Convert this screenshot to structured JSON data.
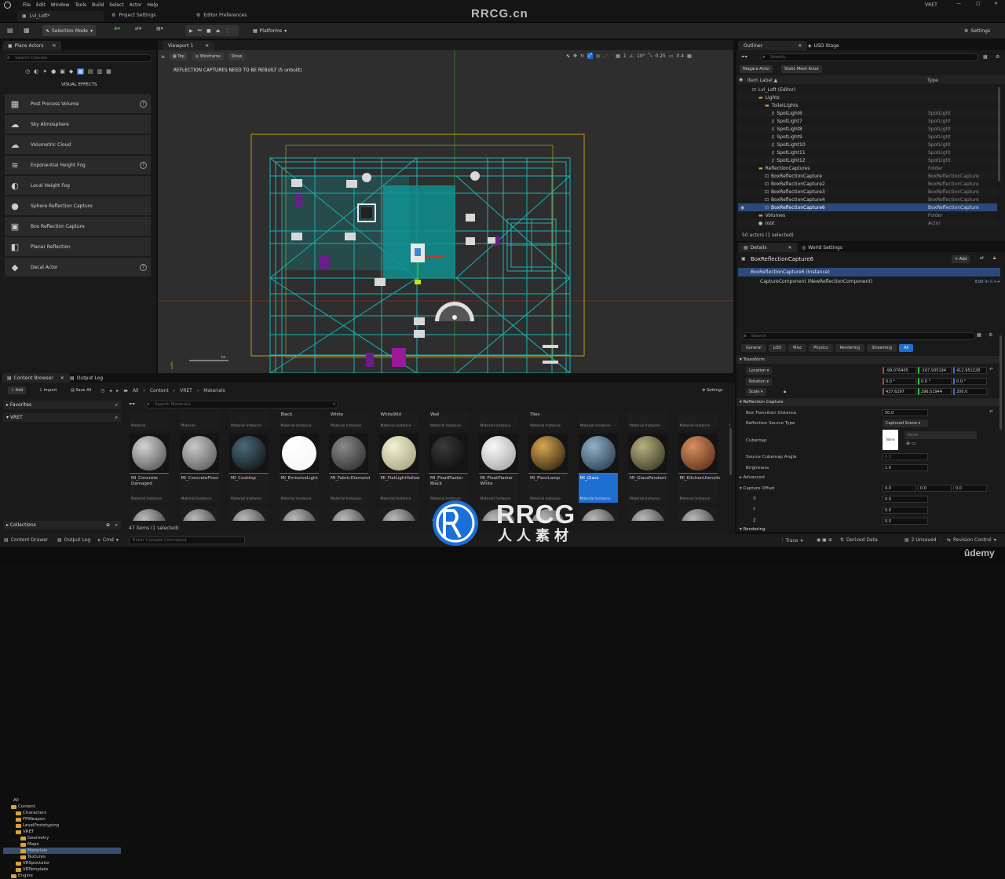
{
  "menu": [
    "File",
    "Edit",
    "Window",
    "Tools",
    "Build",
    "Select",
    "Actor",
    "Help"
  ],
  "window": {
    "level_tab": "Lvl_Loft*",
    "project_settings": "Project Settings",
    "editor_prefs": "Editor Preferences",
    "user": "VRET"
  },
  "watermark": {
    "top": "RRCG.cn",
    "logo_main": "RRCG",
    "logo_sub": "人人素材",
    "udemy": "ûdemy"
  },
  "toolbar": {
    "selection_mode": "Selection Mode",
    "platforms": "Platforms",
    "settings": "Settings"
  },
  "place_actors": {
    "tab": "Place Actors",
    "search_placeholder": "Search Classes",
    "category": "VISUAL EFFECTS",
    "items": [
      {
        "label": "Post Process Volume",
        "help": true
      },
      {
        "label": "Sky Atmosphere",
        "help": false
      },
      {
        "label": "Volumetric Cloud",
        "help": false
      },
      {
        "label": "Exponential Height Fog",
        "help": true
      },
      {
        "label": "Local Height Fog",
        "help": false
      },
      {
        "label": "Sphere Reflection Capture",
        "help": false
      },
      {
        "label": "Box Reflection Capture",
        "help": false
      },
      {
        "label": "Planar Reflection",
        "help": false
      },
      {
        "label": "Decal Actor",
        "help": true
      }
    ]
  },
  "viewport": {
    "tab": "Viewport 1",
    "view": "Top",
    "mode": "Wireframe",
    "show": "Show",
    "warning": "REFLECTION CAPTURES NEED TO BE REBUILT (5 unbuilt)",
    "snap_angle": "10°",
    "snap_scale": "0.25",
    "cam_speed": "0.4",
    "grid": "1",
    "scale_bar": "1m"
  },
  "outliner": {
    "tab": "Outliner",
    "tab2": "USD Stage",
    "search_placeholder": "Search...",
    "filters": [
      "Niagara Actor",
      "Static Mesh Actor"
    ],
    "col_label": "Item Label ▲",
    "col_type": "Type",
    "rows": [
      {
        "label": "Lvl_Loft (Editor)",
        "type": "",
        "indent": 1
      },
      {
        "label": "Lights",
        "type": "",
        "indent": 2
      },
      {
        "label": "ToiletLights",
        "type": "",
        "indent": 3
      },
      {
        "label": "SpotLight6",
        "type": "SpotLight",
        "indent": 4
      },
      {
        "label": "SpotLight7",
        "type": "SpotLight",
        "indent": 4
      },
      {
        "label": "SpotLight8",
        "type": "SpotLight",
        "indent": 4
      },
      {
        "label": "SpotLight9",
        "type": "SpotLight",
        "indent": 4
      },
      {
        "label": "SpotLight10",
        "type": "SpotLight",
        "indent": 4
      },
      {
        "label": "SpotLight11",
        "type": "SpotLight",
        "indent": 4
      },
      {
        "label": "SpotLight12",
        "type": "SpotLight",
        "indent": 4
      },
      {
        "label": "ReflectionCaptures",
        "type": "Folder",
        "indent": 2
      },
      {
        "label": "BoxReflectionCapture",
        "type": "BoxReflectionCapture",
        "indent": 3
      },
      {
        "label": "BoxReflectionCapture2",
        "type": "BoxReflectionCapture",
        "indent": 3
      },
      {
        "label": "BoxReflectionCapture3",
        "type": "BoxReflectionCapture",
        "indent": 3
      },
      {
        "label": "BoxReflectionCapture4",
        "type": "BoxReflectionCapture",
        "indent": 3
      },
      {
        "label": "BoxReflectionCapture6",
        "type": "BoxReflectionCapture",
        "indent": 3,
        "selected": true
      },
      {
        "label": "Volumes",
        "type": "Folder",
        "indent": 2
      },
      {
        "label": "root",
        "type": "Actor",
        "indent": 2
      }
    ],
    "status": "50 actors (1 selected)"
  },
  "details": {
    "tab": "Details",
    "tab2": "World Settings",
    "title": "BoxReflectionCapture6",
    "add": "+ Add",
    "instance": "BoxReflectionCapture6 (Instance)",
    "component": "CaptureComponent (NewReflectionComponent)",
    "edit_cpp": "Edit in C++",
    "search_placeholder": "Search",
    "tabs": [
      "General",
      "LOD",
      "Misc",
      "Physics",
      "Rendering",
      "Streaming",
      "All"
    ],
    "transform": "Transform",
    "location": {
      "label": "Location",
      "x": "-99.076405",
      "y": "-167.935194",
      "z": "412.951228"
    },
    "rotation": {
      "label": "Rotation",
      "x": "0.0 °",
      "y": "0.0 °",
      "z": "0.0 °"
    },
    "scale": {
      "label": "Scale",
      "x": "437.6297",
      "y": "296.51944",
      "z": "200.0"
    },
    "reflection": "Reflection Capture",
    "box_dist_label": "Box Transition Distance",
    "box_dist": "50.0",
    "source_label": "Reflection Source Type",
    "source": "Captured Scene",
    "cubemap_label": "Cubemap",
    "cubemap_none": "None",
    "cubemap_select": "None",
    "angle_label": "Source Cubemap Angle",
    "angle": "0.0",
    "brightness_label": "Brightness",
    "brightness": "1.0",
    "advanced": "Advanced",
    "offset_label": "Capture Offset",
    "offset_vals": [
      "0.0",
      "0.0",
      "0.0"
    ],
    "x_label": "X",
    "x": "0.0",
    "y_label": "Y",
    "y": "0.0",
    "z_label": "Z",
    "z": "0.0",
    "rendering": "Rendering"
  },
  "content": {
    "tab": "Content Browser",
    "tab2": "Output Log",
    "add": "Add",
    "import": "Import",
    "save_all": "Save All",
    "crumbs": [
      "All",
      "Content",
      "VRET",
      "Materials"
    ],
    "settings": "Settings",
    "favorites": "Favorites",
    "project": "VRET",
    "search_placeholder": "Search Materials",
    "tree": [
      {
        "label": "All",
        "indent": 0
      },
      {
        "label": "Content",
        "indent": 1
      },
      {
        "label": "Characters",
        "indent": 2
      },
      {
        "label": "FPWeapon",
        "indent": 2
      },
      {
        "label": "LevelPrototyping",
        "indent": 2
      },
      {
        "label": "VRET",
        "indent": 2
      },
      {
        "label": "Geometry",
        "indent": 3
      },
      {
        "label": "Maps",
        "indent": 3
      },
      {
        "label": "Materials",
        "indent": 3,
        "selected": true
      },
      {
        "label": "Textures",
        "indent": 3
      },
      {
        "label": "VRSpectator",
        "indent": 2
      },
      {
        "label": "VRTemplate",
        "indent": 2
      },
      {
        "label": "Engine",
        "indent": 1
      }
    ],
    "collections": "Collections",
    "top_row": [
      {
        "name": "",
        "kind": "Material"
      },
      {
        "name": "",
        "kind": "Material"
      },
      {
        "name": "",
        "kind": "Material Instance"
      },
      {
        "name": "Black",
        "kind": "Material Instance"
      },
      {
        "name": "White",
        "kind": "Material Instance"
      },
      {
        "name": "White90d",
        "kind": "Material Instance"
      },
      {
        "name": "Wall",
        "kind": "Material Instance"
      },
      {
        "name": "",
        "kind": "Material Instance"
      },
      {
        "name": "Tiles",
        "kind": "Material Instance"
      },
      {
        "name": "",
        "kind": "Material Instance"
      },
      {
        "name": "",
        "kind": "Material Instance"
      },
      {
        "name": "",
        "kind": "Material Instance"
      },
      {
        "name": "",
        "kind": "Material Instance"
      }
    ],
    "assets": [
      {
        "name": "MI_Concrete Damaged",
        "kind": "Material Instance",
        "c1": "#d4d4d4",
        "c2": "#444"
      },
      {
        "name": "MI_ConcreteFloor",
        "kind": "Material Instance",
        "c1": "#c9c9c9",
        "c2": "#4c4c4c"
      },
      {
        "name": "MI_Cooktop",
        "kind": "Material Instance",
        "c1": "#4a6a7a",
        "c2": "#0a0a0a"
      },
      {
        "name": "MI_EmissiveLight",
        "kind": "Material Instance",
        "c1": "#ffffff",
        "c2": "#f4f4f4"
      },
      {
        "name": "MI_FabricDiamond",
        "kind": "Material Instance",
        "c1": "#8a8a8a",
        "c2": "#222"
      },
      {
        "name": "MI_FlatLightYellow",
        "kind": "Material Instance",
        "c1": "#f1f1d4",
        "c2": "#9a9a70"
      },
      {
        "name": "MI_FloatPlaster Black",
        "kind": "Material Instance",
        "c1": "#3a3a3a",
        "c2": "#050505"
      },
      {
        "name": "MI_FloatPlaster White",
        "kind": "Material Instance",
        "c1": "#fafafa",
        "c2": "#9a9a9a"
      },
      {
        "name": "MI_FloorLamp",
        "kind": "Material Instance",
        "c1": "#d8a650",
        "c2": "#1a1208"
      },
      {
        "name": "MI_Glass",
        "kind": "Material Instance",
        "c1": "#8fb0c8",
        "c2": "#1e2e3e",
        "selected": true
      },
      {
        "name": "MI_GlassPendant",
        "kind": "Material Instance",
        "c1": "#b8b080",
        "c2": "#2a2a18"
      },
      {
        "name": "MI_KitchenUtensils",
        "kind": "Material Instance",
        "c1": "#d89060",
        "c2": "#4a2210"
      }
    ],
    "count": "47 items (1 selected)"
  },
  "statusbar": {
    "drawer": "Content Drawer",
    "output": "Output Log",
    "cmd": "Cmd",
    "console_placeholder": "Enter Console Command",
    "trace": "Trace",
    "derived": "Derived Data",
    "unsaved": "2 Unsaved",
    "revision": "Revision Control"
  }
}
